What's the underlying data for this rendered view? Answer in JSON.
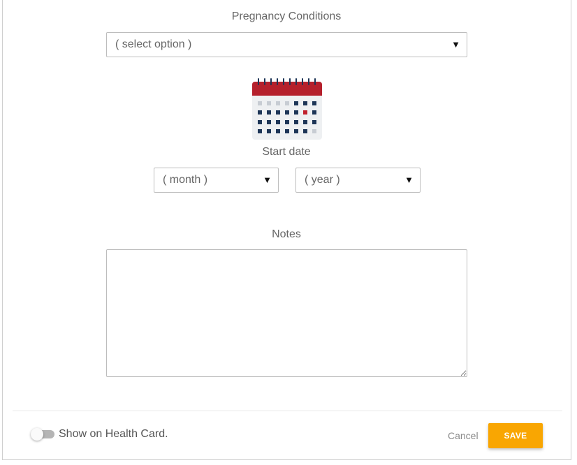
{
  "form": {
    "condition_label": "Pregnancy Conditions",
    "condition_select_value": "( select option )",
    "start_date_label": "Start date",
    "month_select_value": "( month )",
    "year_select_value": "( year )",
    "notes_label": "Notes",
    "notes_value": ""
  },
  "footer": {
    "toggle_label": "Show on Health Card.",
    "toggle_on": false,
    "cancel_label": "Cancel",
    "save_label": "SAVE"
  },
  "icons": {
    "dropdown": "triangle-down-icon",
    "calendar": "calendar-icon"
  },
  "colors": {
    "save_button": "#f9a602",
    "calendar_header": "#b5202c",
    "calendar_dark": "#1d3557",
    "calendar_highlight": "#c0202c",
    "calendar_gray": "#c7ccd3"
  }
}
